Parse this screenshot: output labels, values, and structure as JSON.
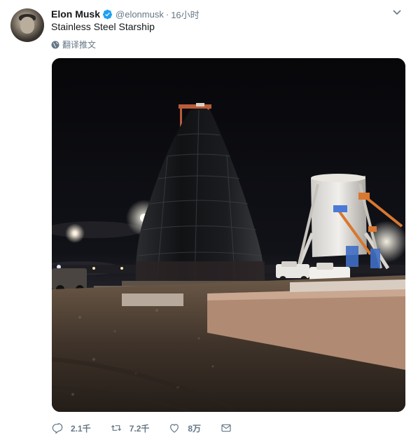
{
  "tweet": {
    "author_name": "Elon Musk",
    "handle": "@elonmusk",
    "separator": "·",
    "time": "16小时",
    "text": "Stainless Steel Starship",
    "translate_label": "翻译推文"
  },
  "actions": {
    "replies": "2.1千",
    "retweets": "7.2千",
    "likes": "8万"
  },
  "colors": {
    "verified": "#1da1f2",
    "secondary_text": "#657786",
    "primary_text": "#14171a"
  },
  "icons": {
    "verified": "verified-badge-icon",
    "caret": "chevron-down-icon",
    "translate": "globe-icon",
    "reply": "reply-icon",
    "retweet": "retweet-icon",
    "like": "heart-icon",
    "dm": "envelope-icon"
  }
}
